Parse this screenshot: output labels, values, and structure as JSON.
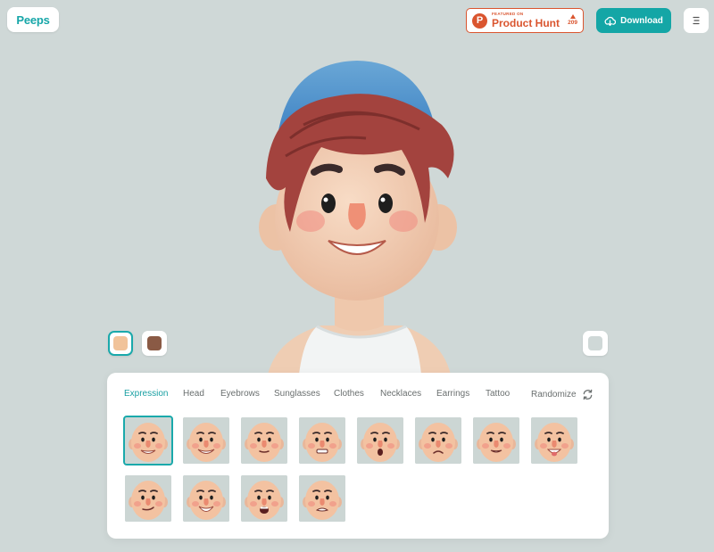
{
  "header": {
    "logo_label": "Peeps",
    "producthunt": {
      "small": "FEATURED ON",
      "big": "Product Hunt",
      "votes": "209"
    },
    "download_label": "Download"
  },
  "swatches": {
    "skin_light": "#f1c39a",
    "skin_dark": "#8a5a45",
    "background": "#cfd8d7"
  },
  "panel": {
    "tabs": [
      "Expression",
      "Head",
      "Eyebrows",
      "Sunglasses",
      "Clothes",
      "Necklaces",
      "Earrings",
      "Tattoo"
    ],
    "active_tab": "Expression",
    "randomize_label": "Randomize",
    "expressions": [
      "smile-teeth",
      "grin",
      "neutral",
      "grimace",
      "surprised-o",
      "frown",
      "clenched",
      "tongue-out",
      "smirk",
      "big-grin",
      "open-shout",
      "worried"
    ]
  },
  "colors": {
    "accent": "#14a6a6",
    "producthunt": "#da552f",
    "page_bg": "#cfd8d7"
  }
}
